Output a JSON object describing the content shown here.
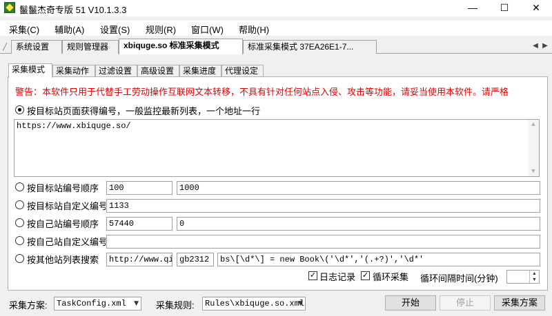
{
  "window": {
    "title": "鬣鬣杰奇专版 51 V10.1.3.3",
    "minimize_glyph": "—",
    "maximize_glyph": "☐",
    "close_glyph": "✕"
  },
  "menu": [
    "采集(C)",
    "辅助(A)",
    "设置(S)",
    "规则(R)",
    "窗口(W)",
    "帮助(H)"
  ],
  "doc_tabs": [
    "系统设置",
    "规则管理器",
    "xbiquge.so 标准采集模式",
    "标准采集模式 37EA26E1-7..."
  ],
  "sub_tabs": [
    "采集模式",
    "采集动作",
    "过滤设置",
    "高级设置",
    "采集进度",
    "代理设定"
  ],
  "warning": "警告：本软件只用于代替手工劳动操作互联网文本转移，不具有针对任何站点入侵、攻击等功能，请妥当使用本软件。请严格",
  "options": {
    "list_mode_label": "按目标站页面获得编号，一般监控最新列表，一个地址一行",
    "list_urls": "https://www.xbiquge.so/",
    "target_seq_label": "按目标站编号顺序",
    "target_seq_from": "100",
    "target_seq_to": "1000",
    "target_custom_label": "按目标站自定义编号",
    "target_custom_value": "1133",
    "own_seq_label": "按自己站编号顺序",
    "own_seq_from": "57440",
    "own_seq_to": "0",
    "own_custom_label": "按自己站自定义编号",
    "own_custom_value": "",
    "other_search_label": "按其他站列表搜索",
    "other_search_url": "http://www.qidian.com/",
    "other_search_encoding": "gb2312",
    "other_search_regex": "bs\\[\\d*\\] = new Book\\('\\d*','(.+?)','\\d*'"
  },
  "checks": {
    "log_label": "日志记录",
    "log_checked": true,
    "loop_label": "循环采集",
    "loop_checked": true,
    "interval_label": "循环间隔时间(分钟)",
    "interval_value": ""
  },
  "bottom": {
    "scheme_label": "采集方案:",
    "scheme_value": "TaskConfig.xml",
    "rule_label": "采集规则:",
    "rule_value": "Rules\\xbiquge.so.xml",
    "start_label": "开始",
    "stop_label": "停止",
    "scheme_button_label": "采集方案"
  }
}
